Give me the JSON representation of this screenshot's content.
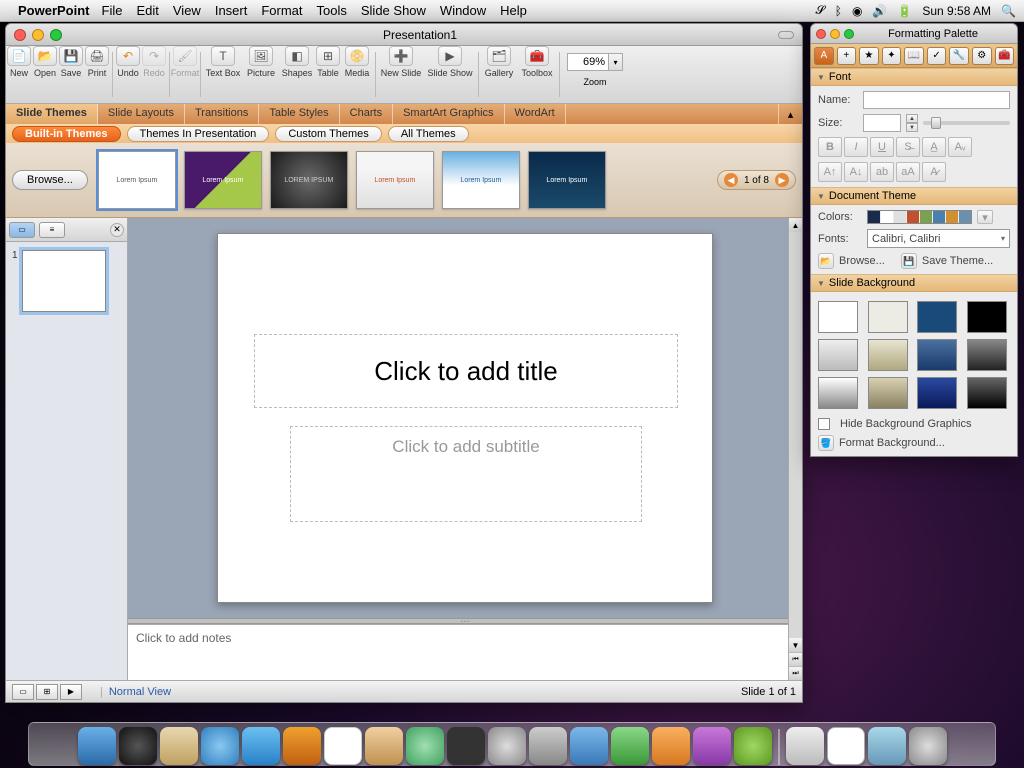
{
  "menubar": {
    "app": "PowerPoint",
    "items": [
      "File",
      "Edit",
      "View",
      "Insert",
      "Format",
      "Tools",
      "Slide Show",
      "Window",
      "Help"
    ],
    "clock": "Sun 9:58 AM"
  },
  "window": {
    "title": "Presentation1"
  },
  "toolbar": {
    "new": "New",
    "open": "Open",
    "save": "Save",
    "print": "Print",
    "undo": "Undo",
    "redo": "Redo",
    "format": "Format",
    "textbox": "Text Box",
    "picture": "Picture",
    "shapes": "Shapes",
    "table": "Table",
    "media": "Media",
    "newslide": "New Slide",
    "slideshow": "Slide Show",
    "gallery": "Gallery",
    "toolbox": "Toolbox",
    "zoom_label": "Zoom",
    "zoom_value": "69%"
  },
  "ribbon": {
    "tabs": [
      "Slide Themes",
      "Slide Layouts",
      "Transitions",
      "Table Styles",
      "Charts",
      "SmartArt Graphics",
      "WordArt"
    ],
    "subtabs": {
      "builtin": "Built-in Themes",
      "inpres": "Themes In Presentation",
      "custom": "Custom Themes",
      "all": "All Themes"
    }
  },
  "gallery": {
    "browse": "Browse...",
    "nav": "1 of 8",
    "sample": "Lorem Ipsum"
  },
  "slide": {
    "title_placeholder": "Click to add title",
    "subtitle_placeholder": "Click to add subtitle",
    "notes_placeholder": "Click to add notes",
    "number": "1"
  },
  "status": {
    "view": "Normal View",
    "pos": "Slide 1 of 1"
  },
  "palette": {
    "title": "Formatting Palette",
    "sections": {
      "font": "Font",
      "theme": "Document Theme",
      "bg": "Slide Background"
    },
    "name_label": "Name:",
    "size_label": "Size:",
    "colors_label": "Colors:",
    "fonts_label": "Fonts:",
    "fonts_value": "Calibri, Calibri",
    "browse": "Browse...",
    "savetheme": "Save Theme...",
    "hidebg": "Hide Background Graphics",
    "formatbg": "Format Background...",
    "theme_colors": [
      "#1a2a4a",
      "#ffffff",
      "#e0e0e0",
      "#c05030",
      "#7aa050",
      "#4a80b0",
      "#d09030",
      "#6a90b0"
    ]
  }
}
